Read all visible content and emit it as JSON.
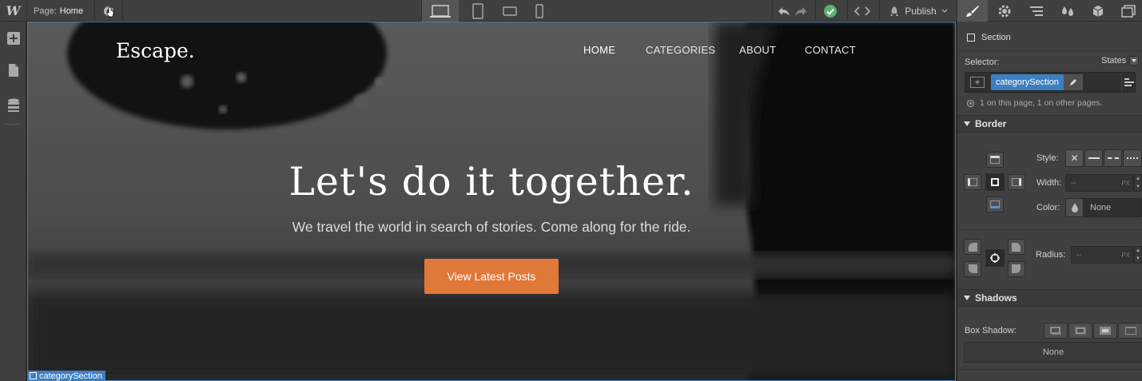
{
  "topbar": {
    "logo": "W",
    "page_prefix": "Page:",
    "page_name": "Home",
    "publish_label": "Publish"
  },
  "canvas": {
    "brand": "Escape.",
    "nav": [
      "HOME",
      "CATEGORIES",
      "ABOUT",
      "CONTACT"
    ],
    "headline": "Let's do it together.",
    "subtitle": "We travel the world in search of stories. Come along for the ride.",
    "cta": "View Latest Posts",
    "selection_label": "categorySection",
    "accent": "#e0783a"
  },
  "panel": {
    "element_type": "Section",
    "selector_label": "Selector:",
    "states_label": "States",
    "selector_class": "categorySection",
    "usage_text": "1 on this page, 1 on other pages.",
    "border": {
      "title": "Border",
      "style_label": "Style:",
      "width_label": "Width:",
      "width_value": "--",
      "width_unit": "PX",
      "color_label": "Color:",
      "color_value": "None",
      "radius_label": "Radius:",
      "radius_value": "--",
      "radius_unit": "PX"
    },
    "shadows": {
      "title": "Shadows",
      "box_shadow_label": "Box Shadow:",
      "box_shadow_value": "None"
    },
    "selector_color": "#3e7fc1"
  }
}
